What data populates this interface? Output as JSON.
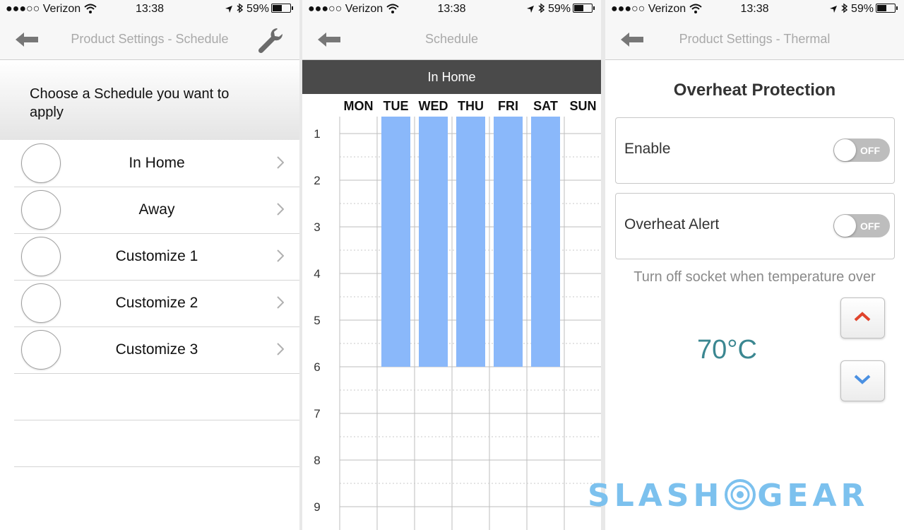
{
  "status_bar": {
    "carrier": "●●●○○ Verizon",
    "time": "13:38",
    "battery": "59%"
  },
  "panel1": {
    "title": "Product Settings - Schedule",
    "prompt": "Choose a Schedule you want to apply",
    "schedules": [
      "In Home",
      "Away",
      "Customize 1",
      "Customize 2",
      "Customize 3"
    ]
  },
  "panel2": {
    "title": "Schedule",
    "schedule_name": "In Home",
    "days": [
      "MON",
      "TUE",
      "WED",
      "THU",
      "FRI",
      "SAT",
      "SUN"
    ],
    "hours": [
      "1",
      "2",
      "3",
      "4",
      "5",
      "6",
      "7",
      "8",
      "9"
    ],
    "active_blocks": [
      {
        "day": "TUE",
        "from_hour": 1,
        "to_hour": 6
      },
      {
        "day": "WED",
        "from_hour": 1,
        "to_hour": 6
      },
      {
        "day": "THU",
        "from_hour": 1,
        "to_hour": 6
      },
      {
        "day": "FRI",
        "from_hour": 1,
        "to_hour": 6
      },
      {
        "day": "SAT",
        "from_hour": 1,
        "to_hour": 6
      }
    ],
    "block_color": "#8ab8fa"
  },
  "panel3": {
    "title": "Product Settings - Thermal",
    "section_title": "Overheat Protection",
    "enable": {
      "label": "Enable",
      "state": "OFF"
    },
    "alert": {
      "label": "Overheat Alert",
      "state": "OFF"
    },
    "hint": "Turn off socket when temperature over",
    "temperature": "70°C",
    "up_color": "#e0442c",
    "down_color": "#4a90e2"
  },
  "watermark": {
    "left": "SLASH",
    "right": "GEAR"
  }
}
